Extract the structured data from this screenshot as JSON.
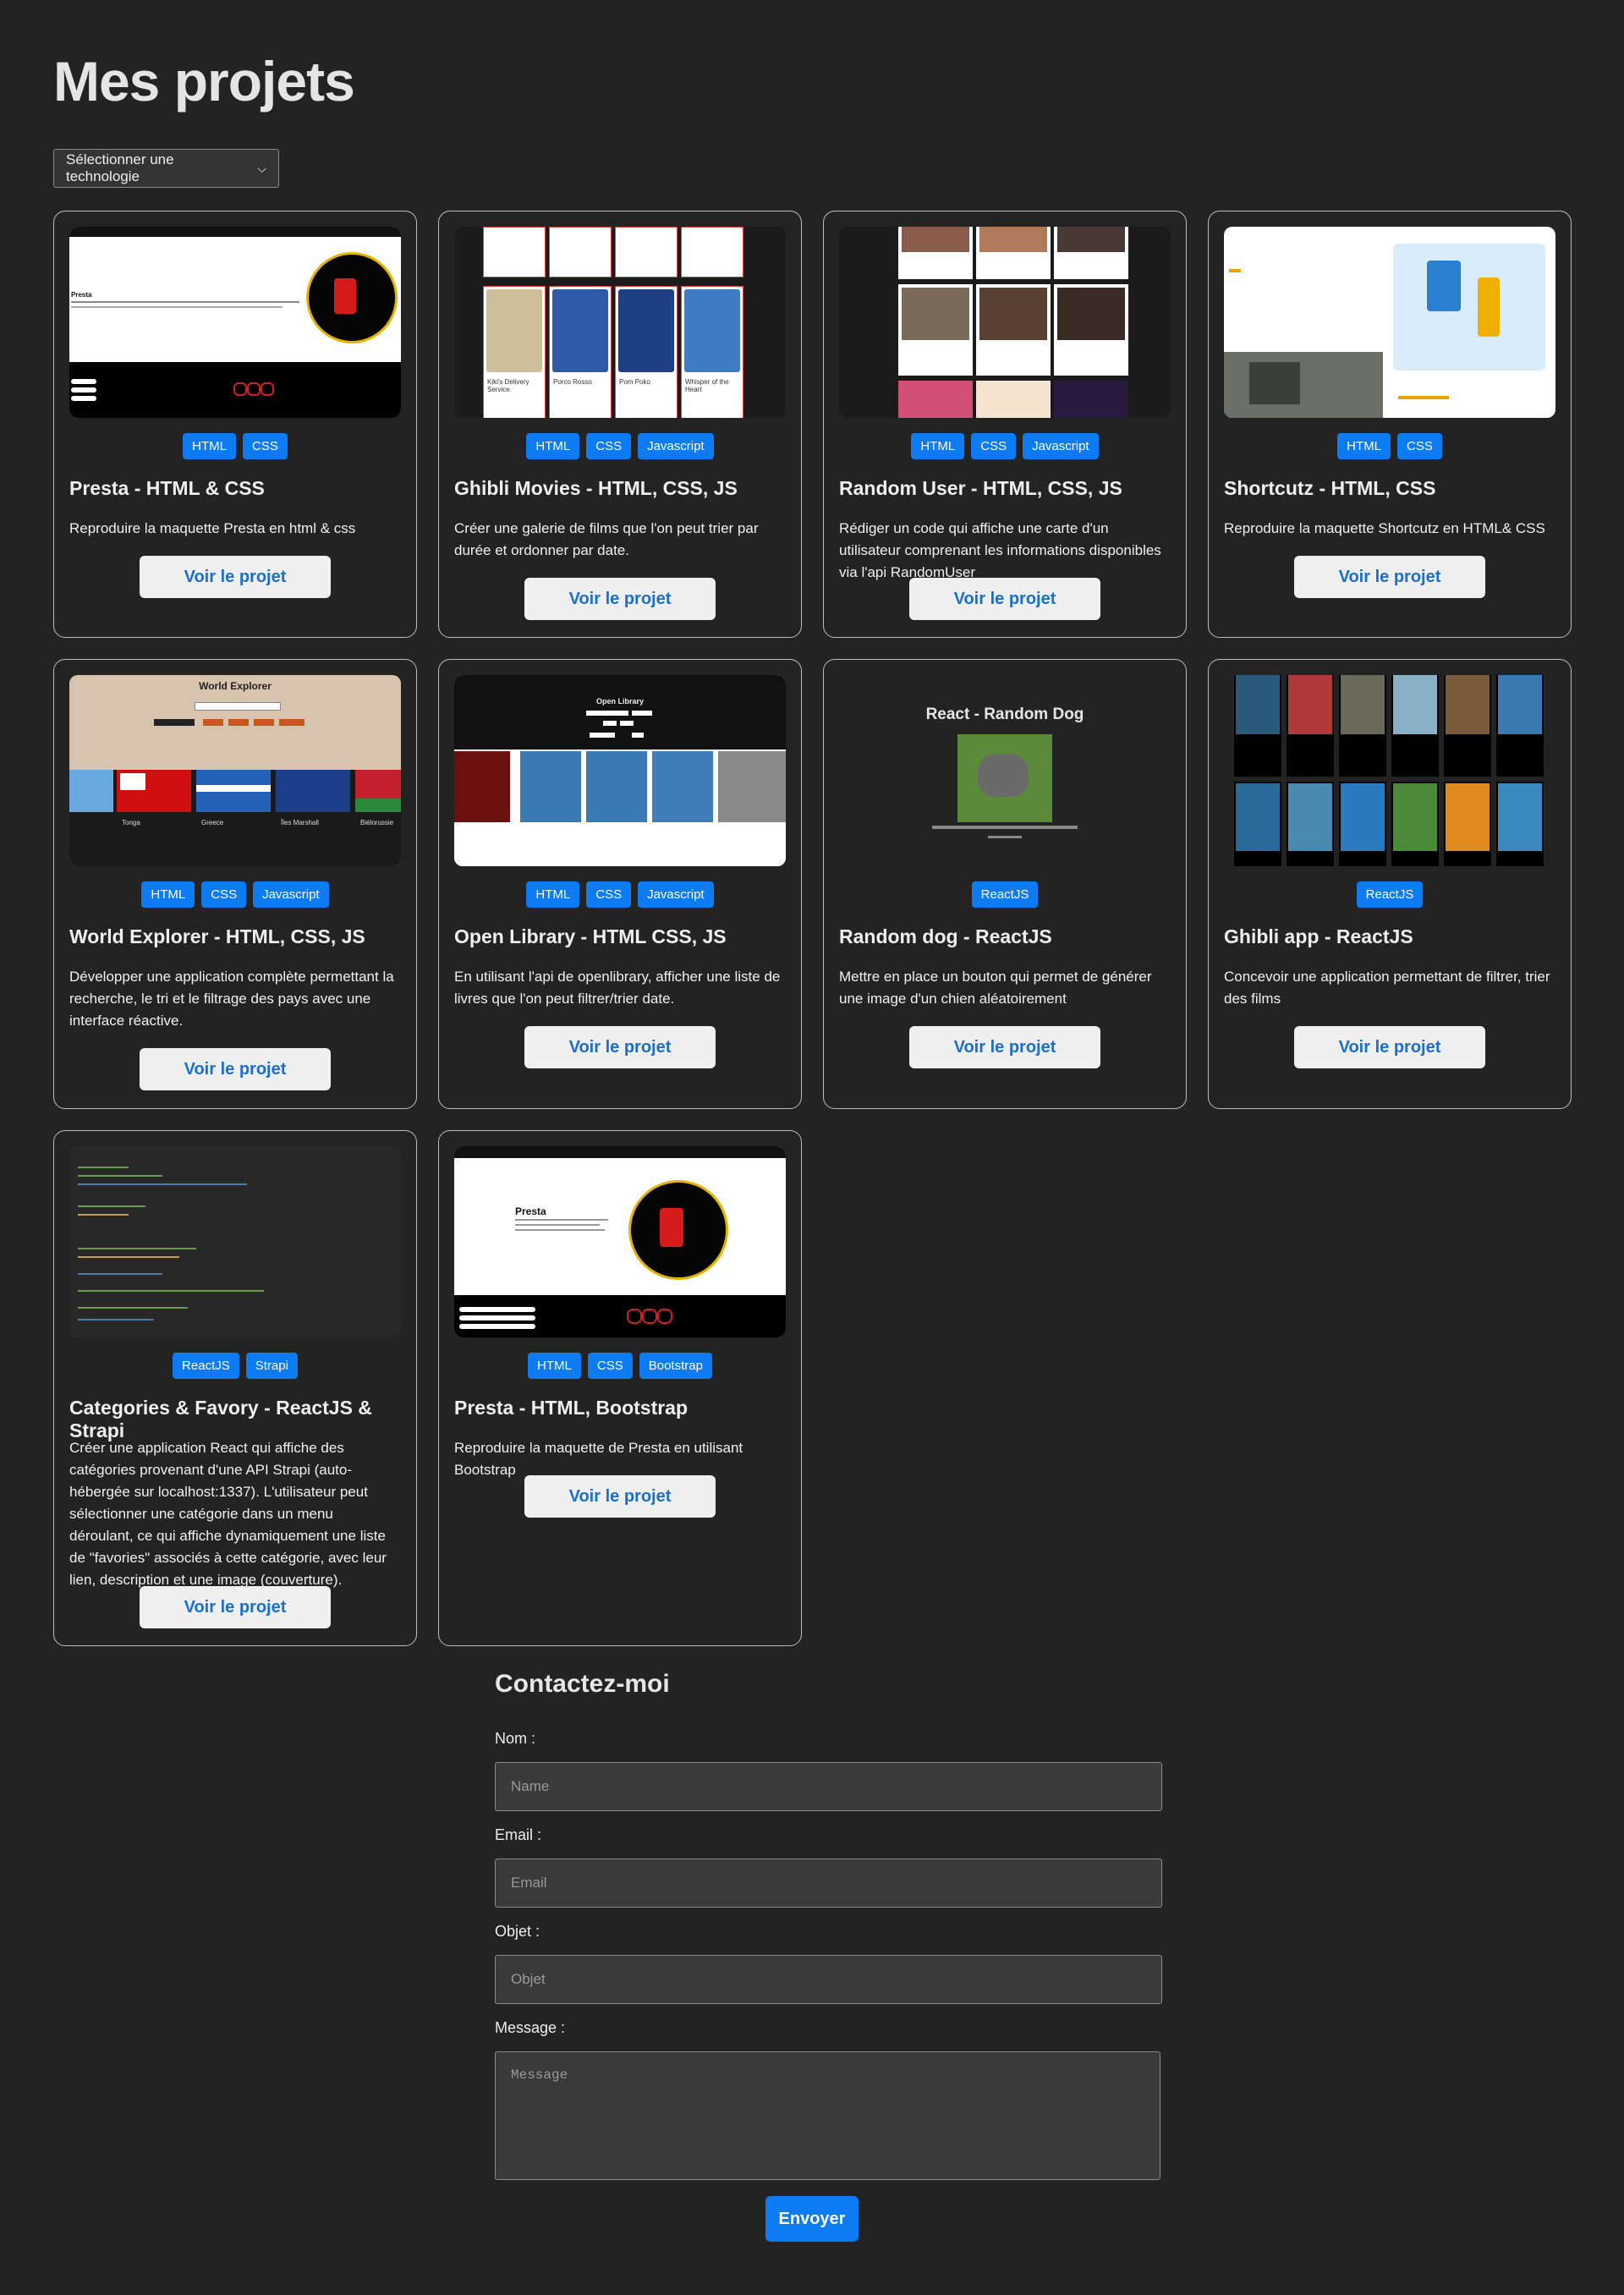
{
  "page": {
    "title": "Mes projets"
  },
  "filter": {
    "label": "Sélectionner une technologie"
  },
  "projects": [
    {
      "title": "Presta - HTML & CSS",
      "desc": "Reproduire la maquette Presta en html & css",
      "tags": [
        "HTML",
        "CSS"
      ],
      "button": "Voir le projet",
      "thumb_text": "Presta"
    },
    {
      "title": "Ghibli Movies - HTML, CSS, JS",
      "desc": "Créer une galerie de films que l'on peut trier par durée et ordonner par date.",
      "tags": [
        "HTML",
        "CSS",
        "Javascript"
      ],
      "button": "Voir le projet",
      "thumb_posters": [
        "Kiki's Delivery Service",
        "Porco Rosso",
        "Pom Poko",
        "Whisper of the Heart"
      ]
    },
    {
      "title": "Random User - HTML, CSS, JS",
      "desc": "Rédiger un code qui affiche une carte d'un utilisateur comprenant les informations disponibles via l'api RandomUser",
      "tags": [
        "HTML",
        "CSS",
        "Javascript"
      ],
      "button": "Voir le projet"
    },
    {
      "title": "Shortcutz - HTML, CSS",
      "desc": "Reproduire la maquette Shortcutz en HTML& CSS",
      "tags": [
        "HTML",
        "CSS"
      ],
      "button": "Voir le projet"
    },
    {
      "title": "World Explorer - HTML, CSS, JS",
      "desc": "Développer une application complète permettant la recherche, le tri et le filtrage des pays avec une interface réactive.",
      "tags": [
        "HTML",
        "CSS",
        "Javascript"
      ],
      "button": "Voir le projet",
      "thumb_text": "World Explorer",
      "thumb_countries": [
        "Tonga",
        "Greece",
        "Îles Marshall",
        "Biélorussie"
      ]
    },
    {
      "title": "Open Library - HTML CSS, JS",
      "desc": "En utilisant l'api de openlibrary, afficher une liste de livres que l'on peut filtrer/trier date.",
      "tags": [
        "HTML",
        "CSS",
        "Javascript"
      ],
      "button": "Voir le projet",
      "thumb_text": "Open Library"
    },
    {
      "title": "Random dog - ReactJS",
      "desc": "Mettre en place un bouton qui permet de générer une image d'un chien aléatoirement",
      "tags": [
        "ReactJS"
      ],
      "button": "Voir le projet",
      "thumb_text": "React - Random Dog"
    },
    {
      "title": "Ghibli app - ReactJS",
      "desc": "Concevoir une application permettant de filtrer, trier des films",
      "tags": [
        "ReactJS"
      ],
      "button": "Voir le projet"
    },
    {
      "title": "Categories & Favory - ReactJS & Strapi",
      "desc": "Créer une application React qui affiche des catégories provenant d'une API Strapi (auto-hébergée sur localhost:1337). L'utilisateur peut sélectionner une catégorie dans un menu déroulant, ce qui affiche dynamiquement une liste de \"favories\" associés à cette catégorie, avec leur lien, description et une image (couverture).",
      "tags": [
        "ReactJS",
        "Strapi"
      ],
      "button": "Voir le projet"
    },
    {
      "title": "Presta - HTML, Bootstrap",
      "desc": "Reproduire la maquette de Presta en utilisant Bootstrap",
      "tags": [
        "HTML",
        "CSS",
        "Bootstrap"
      ],
      "button": "Voir le projet",
      "thumb_text": "Presta"
    }
  ],
  "contact": {
    "title": "Contactez-moi",
    "name_label": "Nom :",
    "name_placeholder": "Name",
    "email_label": "Email :",
    "email_placeholder": "Email",
    "subject_label": "Objet :",
    "subject_placeholder": "Objet",
    "message_label": "Message :",
    "message_placeholder": "Message",
    "submit": "Envoyer"
  },
  "colors": {
    "background": "#232323",
    "accent": "#0d7cf2",
    "button_bg": "#efefef",
    "button_text": "#1a6fcf"
  }
}
